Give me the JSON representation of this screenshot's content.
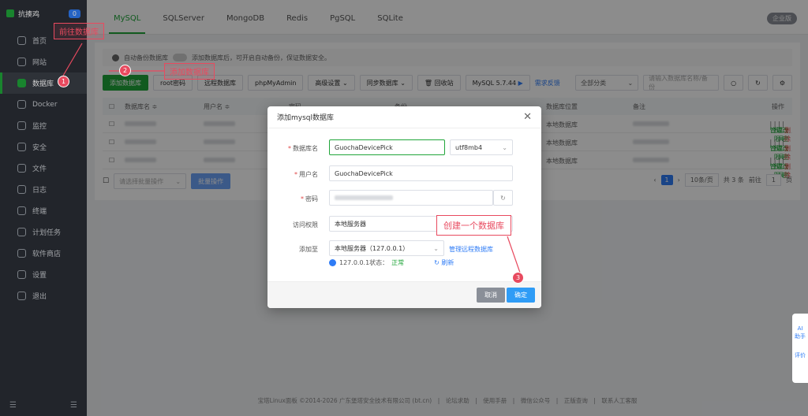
{
  "sidebar": {
    "brand": "抗揍鸡",
    "count": "0",
    "items": [
      {
        "label": "首页",
        "icon": "home-icon"
      },
      {
        "label": "网站",
        "icon": "website-icon"
      },
      {
        "label": "数据库",
        "icon": "database-icon"
      },
      {
        "label": "Docker",
        "icon": "docker-icon"
      },
      {
        "label": "监控",
        "icon": "monitor-icon"
      },
      {
        "label": "安全",
        "icon": "shield-icon"
      },
      {
        "label": "文件",
        "icon": "folder-icon"
      },
      {
        "label": "日志",
        "icon": "log-icon"
      },
      {
        "label": "终端",
        "icon": "terminal-icon"
      },
      {
        "label": "计划任务",
        "icon": "calendar-icon"
      },
      {
        "label": "软件商店",
        "icon": "store-icon"
      },
      {
        "label": "设置",
        "icon": "settings-icon"
      },
      {
        "label": "退出",
        "icon": "logout-icon"
      }
    ],
    "active_index": 2
  },
  "tabs": [
    "MySQL",
    "SQLServer",
    "MongoDB",
    "Redis",
    "PgSQL",
    "SQLite"
  ],
  "enterprise_badge": "企业版",
  "notice": {
    "text": "自动备份数据库",
    "text2": "添加数据库后，可开启自动备份，保证数据安全。"
  },
  "toolbar": {
    "add": "添加数据库",
    "root": "root密码",
    "remote": "远程数据库",
    "phpmyadmin": "phpMyAdmin",
    "advanced": "高级设置",
    "sync": "同步数据库",
    "recycle": "回收站",
    "version": "MySQL 5.7.44",
    "feedback": "需求反馈",
    "category": "全部分类",
    "search_placeholder": "请输入数据库名称/备份"
  },
  "table": {
    "headers": {
      "name": "数据库名 ≑",
      "user": "用户名 ≑",
      "password": "密码",
      "backup": "备份",
      "location": "数据库位置",
      "note": "备注",
      "ops": "操作"
    },
    "rows": [
      {
        "location": "本地数据库"
      },
      {
        "location": "本地数据库"
      },
      {
        "location": "本地数据库"
      }
    ],
    "ops": [
      "管理",
      "权限",
      "工具",
      "改密",
      "删除"
    ],
    "batch_placeholder": "请选择批量操作",
    "batch_button": "批量操作"
  },
  "pager": {
    "current": "1",
    "per_page": "10条/页",
    "total": "共 3 条",
    "goto": "前往",
    "goto_value": "1",
    "page_unit": "页"
  },
  "footer": "宝塔Linux面板 ©2014-2026 广东堡塔安全技术有限公司 (bt.cn)　|　论坛求助　|　使用手册　|　微信公众号　|　正版查询　|　联系人工客服",
  "modal": {
    "title": "添加mysql数据库",
    "fields": {
      "db_name_label": "数据库名",
      "db_name_value": "GuochaDevicePick",
      "charset": "utf8mb4",
      "user_label": "用户名",
      "user_value": "GuochaDevicePick",
      "password_label": "密码",
      "access_label": "访问权限",
      "access_value": "本地服务器",
      "add_to_label": "添加至",
      "add_to_value": "本地服务器（127.0.0.1）",
      "manage_remote": "管理远程数据库",
      "status_prefix": "127.0.0.1状态：",
      "status_value": "正常",
      "refresh": "刷新"
    },
    "cancel": "取消",
    "confirm": "确定"
  },
  "annotations": {
    "step1_text": "前往数据库",
    "step2_text": "添加数据库",
    "step3_text": "创建一个数据库",
    "step1_num": "1",
    "step2_num": "2",
    "step3_num": "3"
  },
  "ai_widget": {
    "line1": "AI",
    "line2": "助手",
    "line3": "评价"
  }
}
